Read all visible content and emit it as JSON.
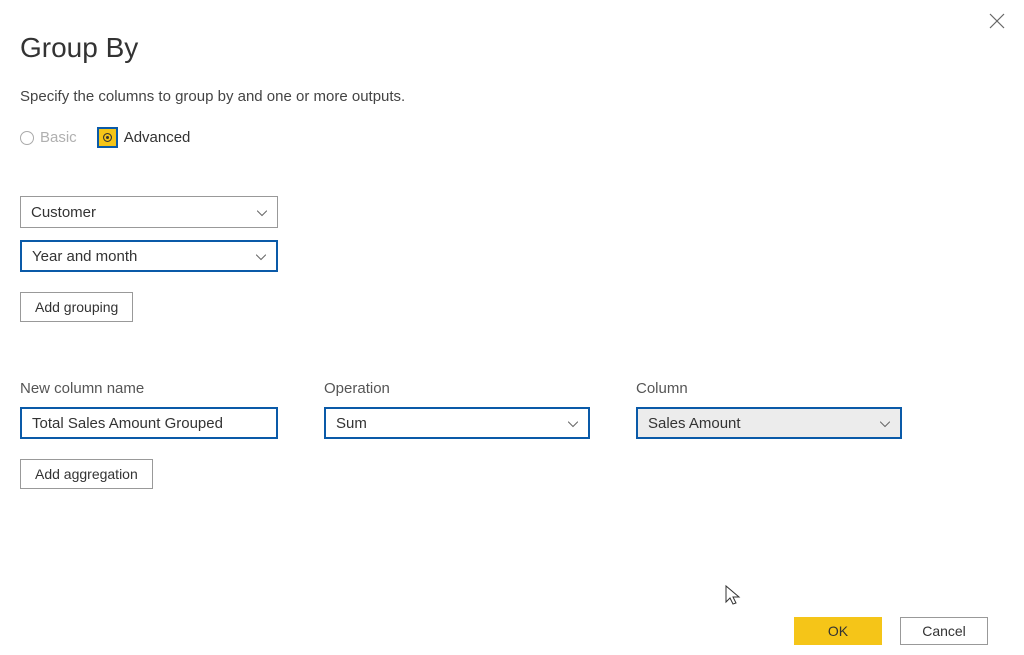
{
  "dialog": {
    "title": "Group By",
    "subtitle": "Specify the columns to group by and one or more outputs.",
    "close_label": "Close"
  },
  "mode": {
    "basic_label": "Basic",
    "advanced_label": "Advanced"
  },
  "grouping": {
    "selects": [
      {
        "value": "Customer",
        "highlighted": false
      },
      {
        "value": "Year and month",
        "highlighted": true
      }
    ],
    "add_button": "Add grouping"
  },
  "aggregation": {
    "headers": {
      "new_column": "New column name",
      "operation": "Operation",
      "column": "Column"
    },
    "row": {
      "new_column_value": "Total Sales Amount Grouped",
      "operation_value": "Sum",
      "column_value": "Sales Amount"
    },
    "add_button": "Add aggregation"
  },
  "footer": {
    "ok": "OK",
    "cancel": "Cancel"
  }
}
